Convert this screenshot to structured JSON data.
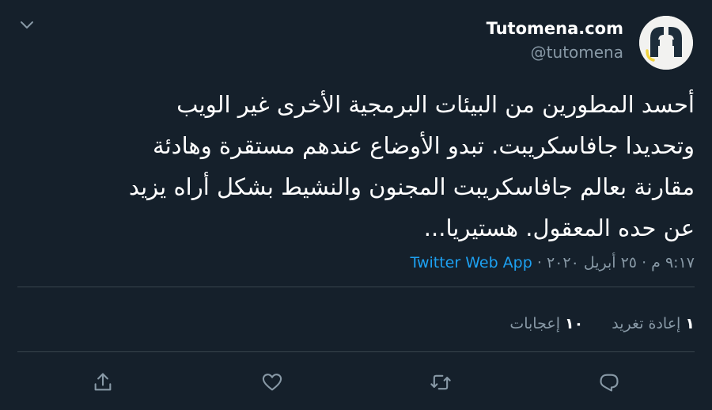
{
  "author": {
    "display_name": "Tutomena.com",
    "handle": "@tutomena"
  },
  "tweet": {
    "lines": [
      "أحسد المطورين من البيئات البرمجية الأخرى غير الويب",
      "وتحديدا جافاسكريبت. تبدو الأوضاع عندهم مستقرة وهادئة",
      "مقارنة بعالم جافاسكريبت المجنون والنشيط بشكل أراه يزيد",
      "عن حده المعقول. هستيريا..."
    ]
  },
  "meta": {
    "time": "٩:١٧ م",
    "separator": "·",
    "date": "٢٥ أبريل ٢٠٢٠",
    "source": "Twitter Web App"
  },
  "stats": {
    "retweets_count": "١",
    "retweets_label": "إعادة تغريد",
    "likes_count": "١٠",
    "likes_label": "إعجابات"
  },
  "icons": {
    "menu": "chevron-down-icon",
    "avatar": "tutomena-logo",
    "reply": "reply-icon",
    "retweet": "retweet-icon",
    "like": "heart-icon",
    "share": "share-icon"
  },
  "colors": {
    "background": "#15202b",
    "text": "#ffffff",
    "secondary": "#8899a6",
    "accent": "#1da1f2",
    "divider": "#38444d",
    "logo_dark": "#1d2d3a",
    "logo_yellow": "#f2d43f"
  }
}
